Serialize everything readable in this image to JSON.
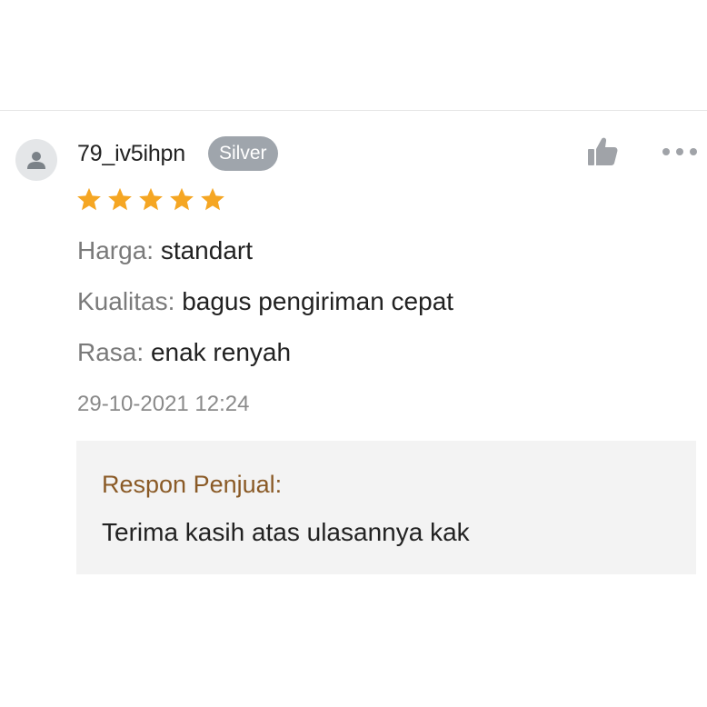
{
  "review": {
    "username": "79_iv5ihpn",
    "badge": "Silver",
    "rating": 5,
    "rating_max": 5,
    "details": [
      {
        "key": "Harga:",
        "value": "standart"
      },
      {
        "key": "Kualitas:",
        "value": "bagus pengiriman cepat"
      },
      {
        "key": "Rasa:",
        "value": "enak renyah"
      }
    ],
    "timestamp": "29-10-2021 12:24",
    "icons": {
      "avatar": "user-icon",
      "like": "thumbs-up-icon",
      "more": "more-options-icon",
      "star": "star-icon"
    }
  },
  "seller_response": {
    "title": "Respon Penjual:",
    "text": "Terima kasih atas ulasannya kak"
  },
  "colors": {
    "star": "#f5a623",
    "badge_bg": "#9fa5ac",
    "response_title": "#8a5a26",
    "response_bg": "#f3f3f3",
    "icon_gray": "#a0a3a8"
  }
}
